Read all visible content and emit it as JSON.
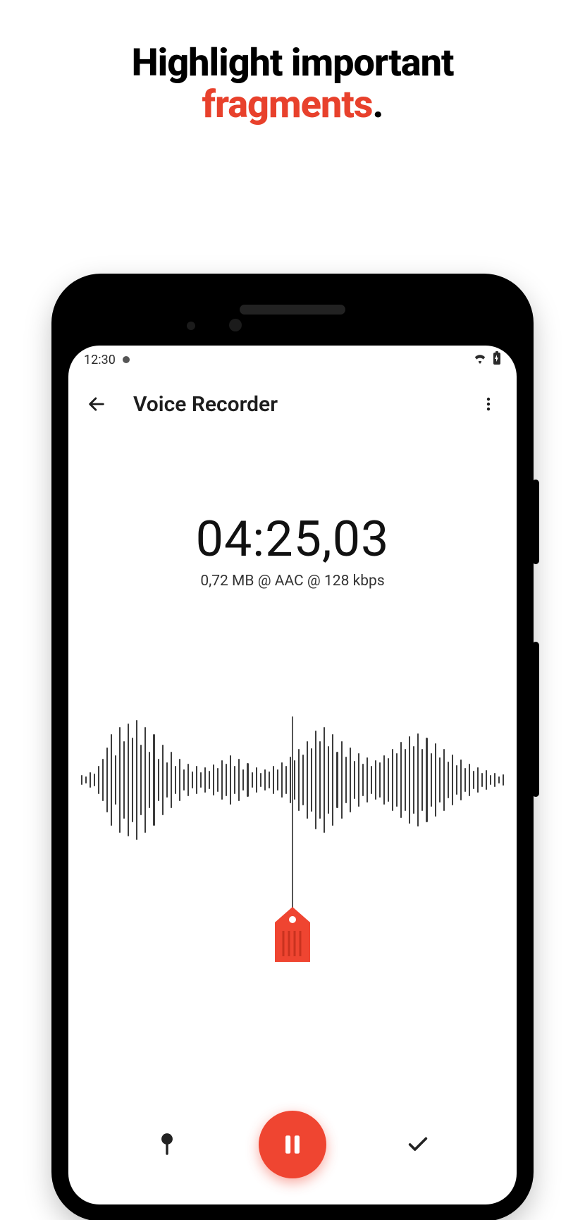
{
  "promo": {
    "line1": "Highlight important",
    "line2_accent": "fragments",
    "line2_punct": "."
  },
  "statusbar": {
    "time": "12:30"
  },
  "appbar": {
    "title": "Voice Recorder"
  },
  "recorder": {
    "elapsed": "04:25,03",
    "meta": "0,72 MB @ AAC @ 128 kbps"
  },
  "colors": {
    "accent": "#ef4531"
  },
  "waveform": {
    "heights": [
      14,
      10,
      22,
      18,
      40,
      60,
      92,
      130,
      70,
      150,
      110,
      160,
      120,
      170,
      100,
      150,
      80,
      130,
      60,
      100,
      50,
      80,
      40,
      60,
      30,
      46,
      24,
      40,
      22,
      36,
      26,
      44,
      34,
      56,
      46,
      70,
      40,
      60,
      30,
      48,
      22,
      36,
      20,
      30,
      24,
      40,
      30,
      50,
      40,
      66,
      56,
      88,
      72,
      110,
      90,
      140,
      110,
      150,
      96,
      130,
      80,
      110,
      66,
      92,
      54,
      76,
      46,
      64,
      40,
      56,
      50,
      70,
      62,
      88,
      76,
      108,
      88,
      124,
      96,
      132,
      88,
      120,
      76,
      104,
      64,
      88,
      52,
      72,
      42,
      58,
      34,
      46,
      26,
      36,
      20,
      28,
      14,
      20,
      10,
      16
    ]
  }
}
